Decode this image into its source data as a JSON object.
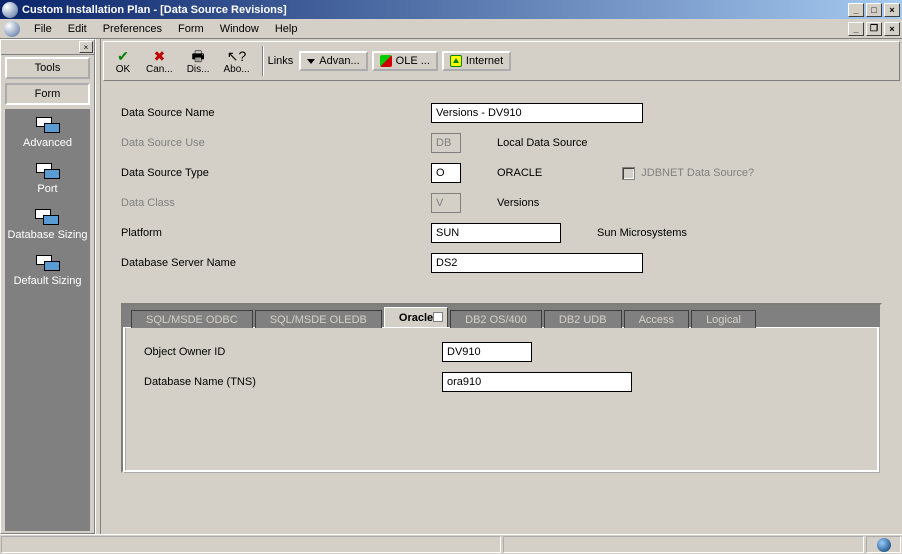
{
  "window": {
    "title": "Custom Installation Plan - [Data Source Revisions]"
  },
  "menu": {
    "file": "File",
    "edit": "Edit",
    "preferences": "Preferences",
    "form": "Form",
    "window": "Window",
    "help": "Help"
  },
  "sidebar": {
    "tab_tools": "Tools",
    "tab_form": "Form",
    "items": [
      {
        "label": "Advanced"
      },
      {
        "label": "Port"
      },
      {
        "label": "Database Sizing"
      },
      {
        "label": "Default Sizing"
      }
    ]
  },
  "toolbar": {
    "ok": "OK",
    "cancel": "Can...",
    "display": "Dis...",
    "about": "Abo...",
    "links": "Links",
    "advan": "Advan...",
    "ole": "OLE ...",
    "internet": "Internet"
  },
  "form": {
    "labels": {
      "ds_name": "Data Source Name",
      "ds_use": "Data Source Use",
      "ds_type": "Data Source Type",
      "data_class": "Data Class",
      "platform": "Platform",
      "db_server": "Database Server Name",
      "jdbnet": "JDBNET Data Source?"
    },
    "values": {
      "ds_name": "Versions - DV910",
      "ds_use": "DB",
      "ds_use_desc": "Local Data Source",
      "ds_type": "O",
      "ds_type_desc": "ORACLE",
      "data_class": "V",
      "data_class_desc": "Versions",
      "platform": "SUN",
      "platform_desc": "Sun Microsystems",
      "db_server": "DS2"
    }
  },
  "tabs": {
    "sql_odbc": "SQL/MSDE ODBC",
    "sql_oledb": "SQL/MSDE OLEDB",
    "oracle": "Oracle",
    "db2_os400": "DB2 OS/400",
    "db2_udb": "DB2 UDB",
    "access": "Access",
    "logical": "Logical"
  },
  "tab_panel": {
    "labels": {
      "owner_id": "Object Owner ID",
      "db_tns": "Database Name (TNS)"
    },
    "values": {
      "owner_id": "DV910",
      "db_tns": "ora910"
    }
  }
}
